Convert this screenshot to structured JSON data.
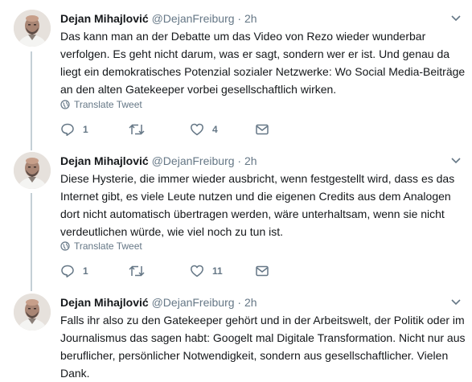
{
  "colors": {
    "text": "#14171a",
    "muted": "#657786",
    "thread_line": "#c4cfd6"
  },
  "tweets": [
    {
      "name": "Dejan Mihajlović",
      "handle": "@DejanFreiburg",
      "sep": "·",
      "time": "2h",
      "lines": [
        "Das kann man an der Debatte um das Video von Rezo wieder wunderbar",
        "verfolgen. Es geht nicht darum, was er sagt, sondern wer er ist. Und genau da",
        "liegt ein demokratisches Potenzial sozialer Netzwerke: Wo Social Media-Beiträge",
        "an den alten Gatekeeper vorbei gesellschaftlich wirken."
      ],
      "translate": "Translate Tweet",
      "replies": "1",
      "retweets": "",
      "likes": "4"
    },
    {
      "name": "Dejan Mihajlović",
      "handle": "@DejanFreiburg",
      "sep": "·",
      "time": "2h",
      "lines": [
        "Diese Hysterie, die immer wieder ausbricht, wenn festgestellt wird, dass es das",
        "Internet gibt, es viele Leute nutzen und die eigenen Credits aus dem Analogen",
        "dort nicht automatisch übertragen werden, wäre unterhaltsam, wenn sie nicht",
        "verdeutlichen würde, wie viel noch zu tun ist."
      ],
      "translate": "Translate Tweet",
      "replies": "1",
      "retweets": "",
      "likes": "11"
    },
    {
      "name": "Dejan Mihajlović",
      "handle": "@DejanFreiburg",
      "sep": "·",
      "time": "2h",
      "lines": [
        "Falls ihr also zu den Gatekeeper gehört und in der Arbeitswelt, der Politik oder im",
        "Journalismus das sagen habt: Googelt mal Digitale Transformation. Nicht nur aus",
        "beruflicher, persönlicher Notwendigkeit, sondern aus gesellschaftlicher. Vielen",
        "Dank."
      ]
    }
  ]
}
